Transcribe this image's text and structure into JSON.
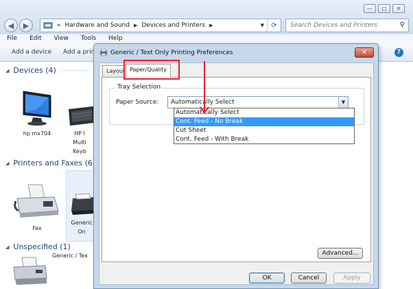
{
  "window": {
    "caption_buttons": [
      "—",
      "▢",
      "✕"
    ]
  },
  "nav": {
    "back_glyph": "◀",
    "forward_glyph": "▶",
    "breadcrumb": [
      "«",
      "Hardware and Sound",
      "Devices and Printers"
    ],
    "search_placeholder": "Search Devices and Printers"
  },
  "menu": [
    "File",
    "Edit",
    "View",
    "Tools",
    "Help"
  ],
  "commands": {
    "add_device": "Add a device",
    "add_printer": "Add a print"
  },
  "groups": {
    "devices": "Devices (4)",
    "printers": "Printers and Faxes (6)",
    "unspecified": "Unspecified (1)"
  },
  "tiles": {
    "monitor_label": "hp mx704",
    "keyboard_label_lines": [
      "HP I",
      "Multi",
      "Keyb"
    ],
    "fax_label": "Fax",
    "generic_label_lines": [
      "Generic",
      "On"
    ],
    "unspecified_label": "Generic / Tex"
  },
  "dialog": {
    "title": "Generic / Text Only Printing Preferences",
    "close_glyph": "✕",
    "tabs": [
      "Layout",
      "Paper/Quality"
    ],
    "active_tab": 1,
    "group_label": "Tray Selection",
    "paper_source_label": "Paper Source:",
    "paper_source_value": "Automatically Select",
    "dropdown_options": [
      "Automatically Select",
      "Cont. Feed - No Break",
      "Cut Sheet",
      "Cont. Feed - With Break"
    ],
    "highlighted_option": 1,
    "advanced_button": "Advanced...",
    "ok_button": "OK",
    "cancel_button": "Cancel",
    "apply_button": "Apply"
  },
  "colors": {
    "annotation_red": "#e8202a",
    "selection_blue": "#3399ff",
    "group_header_blue": "#1e3f7a"
  }
}
